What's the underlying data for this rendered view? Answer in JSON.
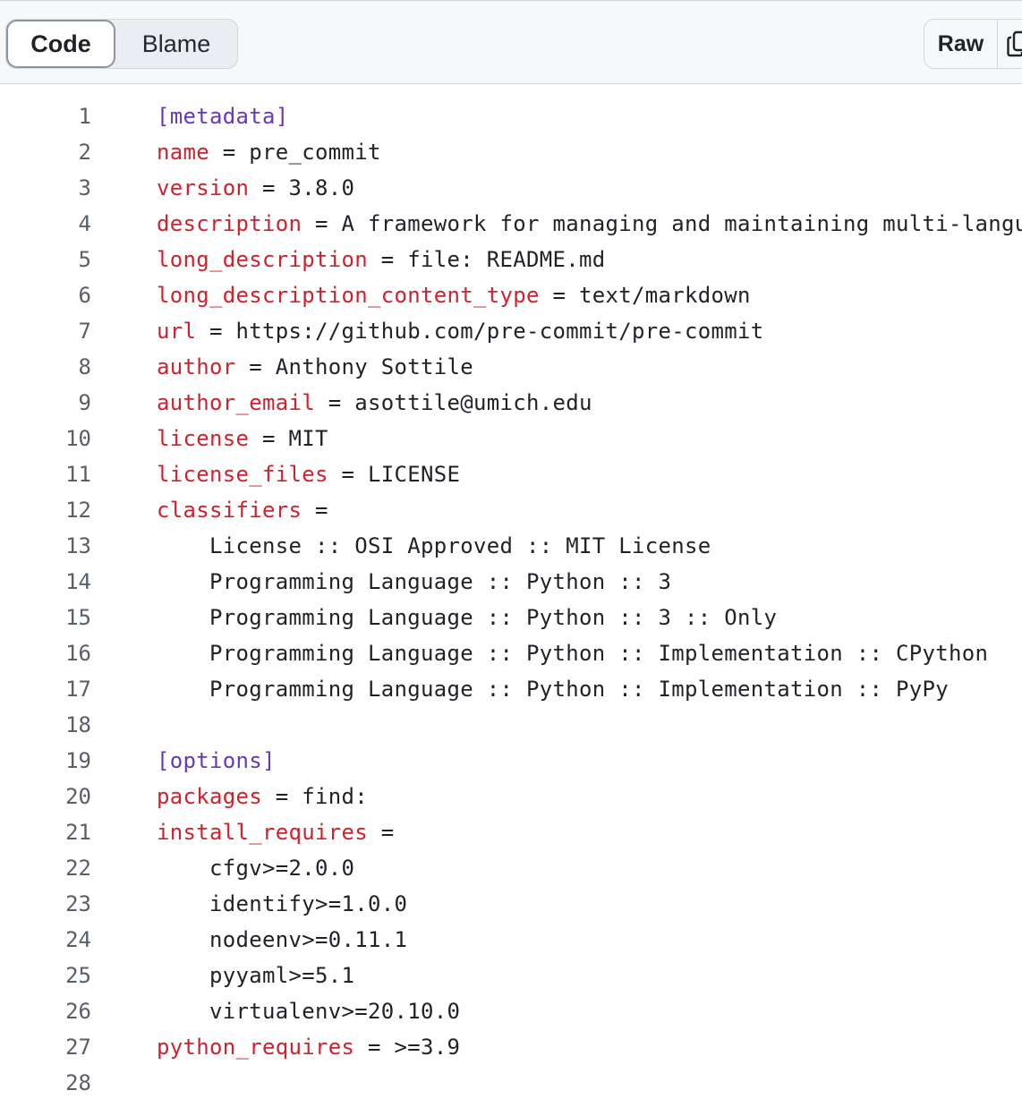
{
  "toolbar": {
    "code_label": "Code",
    "blame_label": "Blame",
    "raw_label": "Raw",
    "copy_icon": "copy-icon"
  },
  "colors": {
    "section": "#6639ba",
    "key": "#cf222e",
    "text": "#1f2328",
    "line_number": "#57606a"
  },
  "lines": [
    {
      "n": "1",
      "section": "[metadata]",
      "key": "",
      "rest": ""
    },
    {
      "n": "2",
      "section": "",
      "key": "name",
      "rest": " = pre_commit"
    },
    {
      "n": "3",
      "section": "",
      "key": "version",
      "rest": " = 3.8.0"
    },
    {
      "n": "4",
      "section": "",
      "key": "description",
      "rest": " = A framework for managing and maintaining multi-langua"
    },
    {
      "n": "5",
      "section": "",
      "key": "long_description",
      "rest": " = file: README.md"
    },
    {
      "n": "6",
      "section": "",
      "key": "long_description_content_type",
      "rest": " = text/markdown"
    },
    {
      "n": "7",
      "section": "",
      "key": "url",
      "rest": " = https://github.com/pre-commit/pre-commit"
    },
    {
      "n": "8",
      "section": "",
      "key": "author",
      "rest": " = Anthony Sottile"
    },
    {
      "n": "9",
      "section": "",
      "key": "author_email",
      "rest": " = asottile@umich.edu"
    },
    {
      "n": "10",
      "section": "",
      "key": "license",
      "rest": " = MIT"
    },
    {
      "n": "11",
      "section": "",
      "key": "license_files",
      "rest": " = LICENSE"
    },
    {
      "n": "12",
      "section": "",
      "key": "classifiers",
      "rest": " ="
    },
    {
      "n": "13",
      "section": "",
      "key": "",
      "rest": "    License :: OSI Approved :: MIT License"
    },
    {
      "n": "14",
      "section": "",
      "key": "",
      "rest": "    Programming Language :: Python :: 3"
    },
    {
      "n": "15",
      "section": "",
      "key": "",
      "rest": "    Programming Language :: Python :: 3 :: Only"
    },
    {
      "n": "16",
      "section": "",
      "key": "",
      "rest": "    Programming Language :: Python :: Implementation :: CPython"
    },
    {
      "n": "17",
      "section": "",
      "key": "",
      "rest": "    Programming Language :: Python :: Implementation :: PyPy"
    },
    {
      "n": "18",
      "section": "",
      "key": "",
      "rest": ""
    },
    {
      "n": "19",
      "section": "[options]",
      "key": "",
      "rest": ""
    },
    {
      "n": "20",
      "section": "",
      "key": "packages",
      "rest": " = find:"
    },
    {
      "n": "21",
      "section": "",
      "key": "install_requires",
      "rest": " ="
    },
    {
      "n": "22",
      "section": "",
      "key": "",
      "rest": "    cfgv>=2.0.0"
    },
    {
      "n": "23",
      "section": "",
      "key": "",
      "rest": "    identify>=1.0.0"
    },
    {
      "n": "24",
      "section": "",
      "key": "",
      "rest": "    nodeenv>=0.11.1"
    },
    {
      "n": "25",
      "section": "",
      "key": "",
      "rest": "    pyyaml>=5.1"
    },
    {
      "n": "26",
      "section": "",
      "key": "",
      "rest": "    virtualenv>=20.10.0"
    },
    {
      "n": "27",
      "section": "",
      "key": "python_requires",
      "rest": " = >=3.9"
    },
    {
      "n": "28",
      "section": "",
      "key": "",
      "rest": ""
    }
  ]
}
